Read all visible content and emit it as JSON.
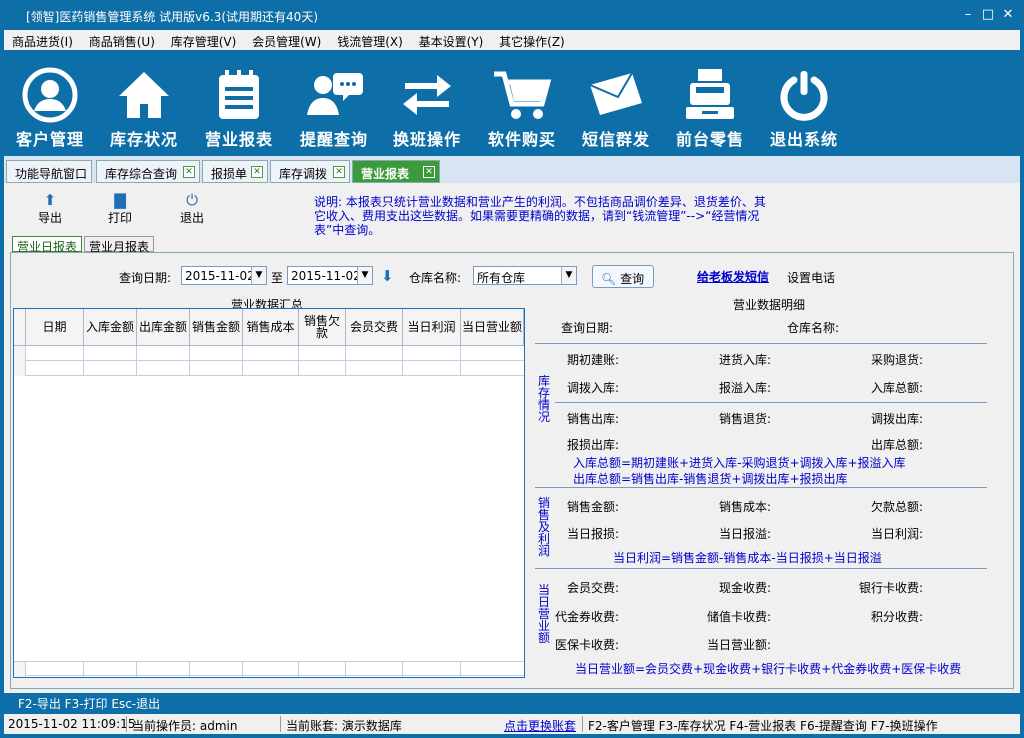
{
  "window": {
    "title": "[领智]医药销售管理系统 试用版v6.3(试用期还有40天)"
  },
  "menu": [
    "商品进货(I)",
    "商品销售(U)",
    "库存管理(V)",
    "会员管理(W)",
    "钱流管理(X)",
    "基本设置(Y)",
    "其它操作(Z)"
  ],
  "toolbar": [
    {
      "label": "客户管理",
      "icon": "user-icon"
    },
    {
      "label": "库存状况",
      "icon": "house-icon"
    },
    {
      "label": "营业报表",
      "icon": "list-icon"
    },
    {
      "label": "提醒查询",
      "icon": "chat-icon"
    },
    {
      "label": "换班操作",
      "icon": "swap-icon"
    },
    {
      "label": "软件购买",
      "icon": "cart-icon"
    },
    {
      "label": "短信群发",
      "icon": "mail-icon"
    },
    {
      "label": "前台零售",
      "icon": "cash-register-icon"
    },
    {
      "label": "退出系统",
      "icon": "power-icon"
    }
  ],
  "tabs": [
    "功能导航窗口",
    "库存综合查询",
    "报损单",
    "库存调拨",
    "营业报表"
  ],
  "actions": {
    "export": "导出",
    "print": "打印",
    "exit": "退出"
  },
  "note": "说明: 本报表只统计营业数据和营业产生的利润。不包括商品调价差异、退货差价、其它收入、费用支出这些数据。如果需要更精确的数据，请到“钱流管理”-->“经营情况表”中查询。",
  "subtabs": [
    "营业日报表",
    "营业月报表"
  ],
  "query": {
    "date_label": "查询日期:",
    "date_from": "2015-11-02",
    "to": "至",
    "date_to": "2015-11-02",
    "warehouse_label": "仓库名称:",
    "warehouse": "所有仓库",
    "button": "查询",
    "sms_link": "给老板发短信",
    "phone_setting": "设置电话"
  },
  "summary": {
    "title": "营业数据汇总",
    "columns": [
      "日期",
      "入库金额",
      "出库金额",
      "销售金额",
      "销售成本",
      "销售欠款",
      "会员交费",
      "当日利润",
      "当日营业额"
    ]
  },
  "detail": {
    "title": "营业数据明细",
    "query_date": "查询日期:",
    "warehouse": "仓库名称:",
    "stock": {
      "section": "库存情况",
      "f1": "期初建账:",
      "f2": "进货入库:",
      "f3": "采购退货:",
      "f4": "调拨入库:",
      "f5": "报溢入库:",
      "f6": "入库总额:",
      "f7": "销售出库:",
      "f8": "销售退货:",
      "f9": "调拨出库:",
      "f10": "报损出库:",
      "f11": "出库总额:",
      "formula1": "入库总额=期初建账+进货入库-采购退货+调拨入库+报溢入库",
      "formula2": "出库总额=销售出库-销售退货+调拨出库+报损出库"
    },
    "profit": {
      "section": "销售及利润",
      "f1": "销售金额:",
      "f2": "销售成本:",
      "f3": "欠款总额:",
      "f4": "当日报损:",
      "f5": "当日报溢:",
      "f6": "当日利润:",
      "formula": "当日利润=销售金额-销售成本-当日报损+当日报溢"
    },
    "revenue": {
      "section": "当日营业额",
      "f1": "会员交费:",
      "f2": "现金收费:",
      "f3": "银行卡收费:",
      "f4": "代金券收费:",
      "f5": "储值卡收费:",
      "f6": "积分收费:",
      "f7": "医保卡收费:",
      "f8": "当日营业额:",
      "formula": "当日营业额=会员交费+现金收费+银行卡收费+代金券收费+医保卡收费"
    }
  },
  "fkeys": "F2-导出  F3-打印  Esc-退出",
  "status": {
    "datetime": "2015-11-02 11:09:15",
    "operator": "当前操作员: admin",
    "account": "当前账套: 演示数据库",
    "switch_link": "点击更换账套",
    "shortcuts": "F2-客户管理 F3-库存状况 F4-营业报表 F6-提醒查询 F7-换班操作"
  },
  "colors": {
    "titlebar": "#0e6fa8",
    "active_tab": "#3b9a3b",
    "note_text": "#0000cc"
  }
}
